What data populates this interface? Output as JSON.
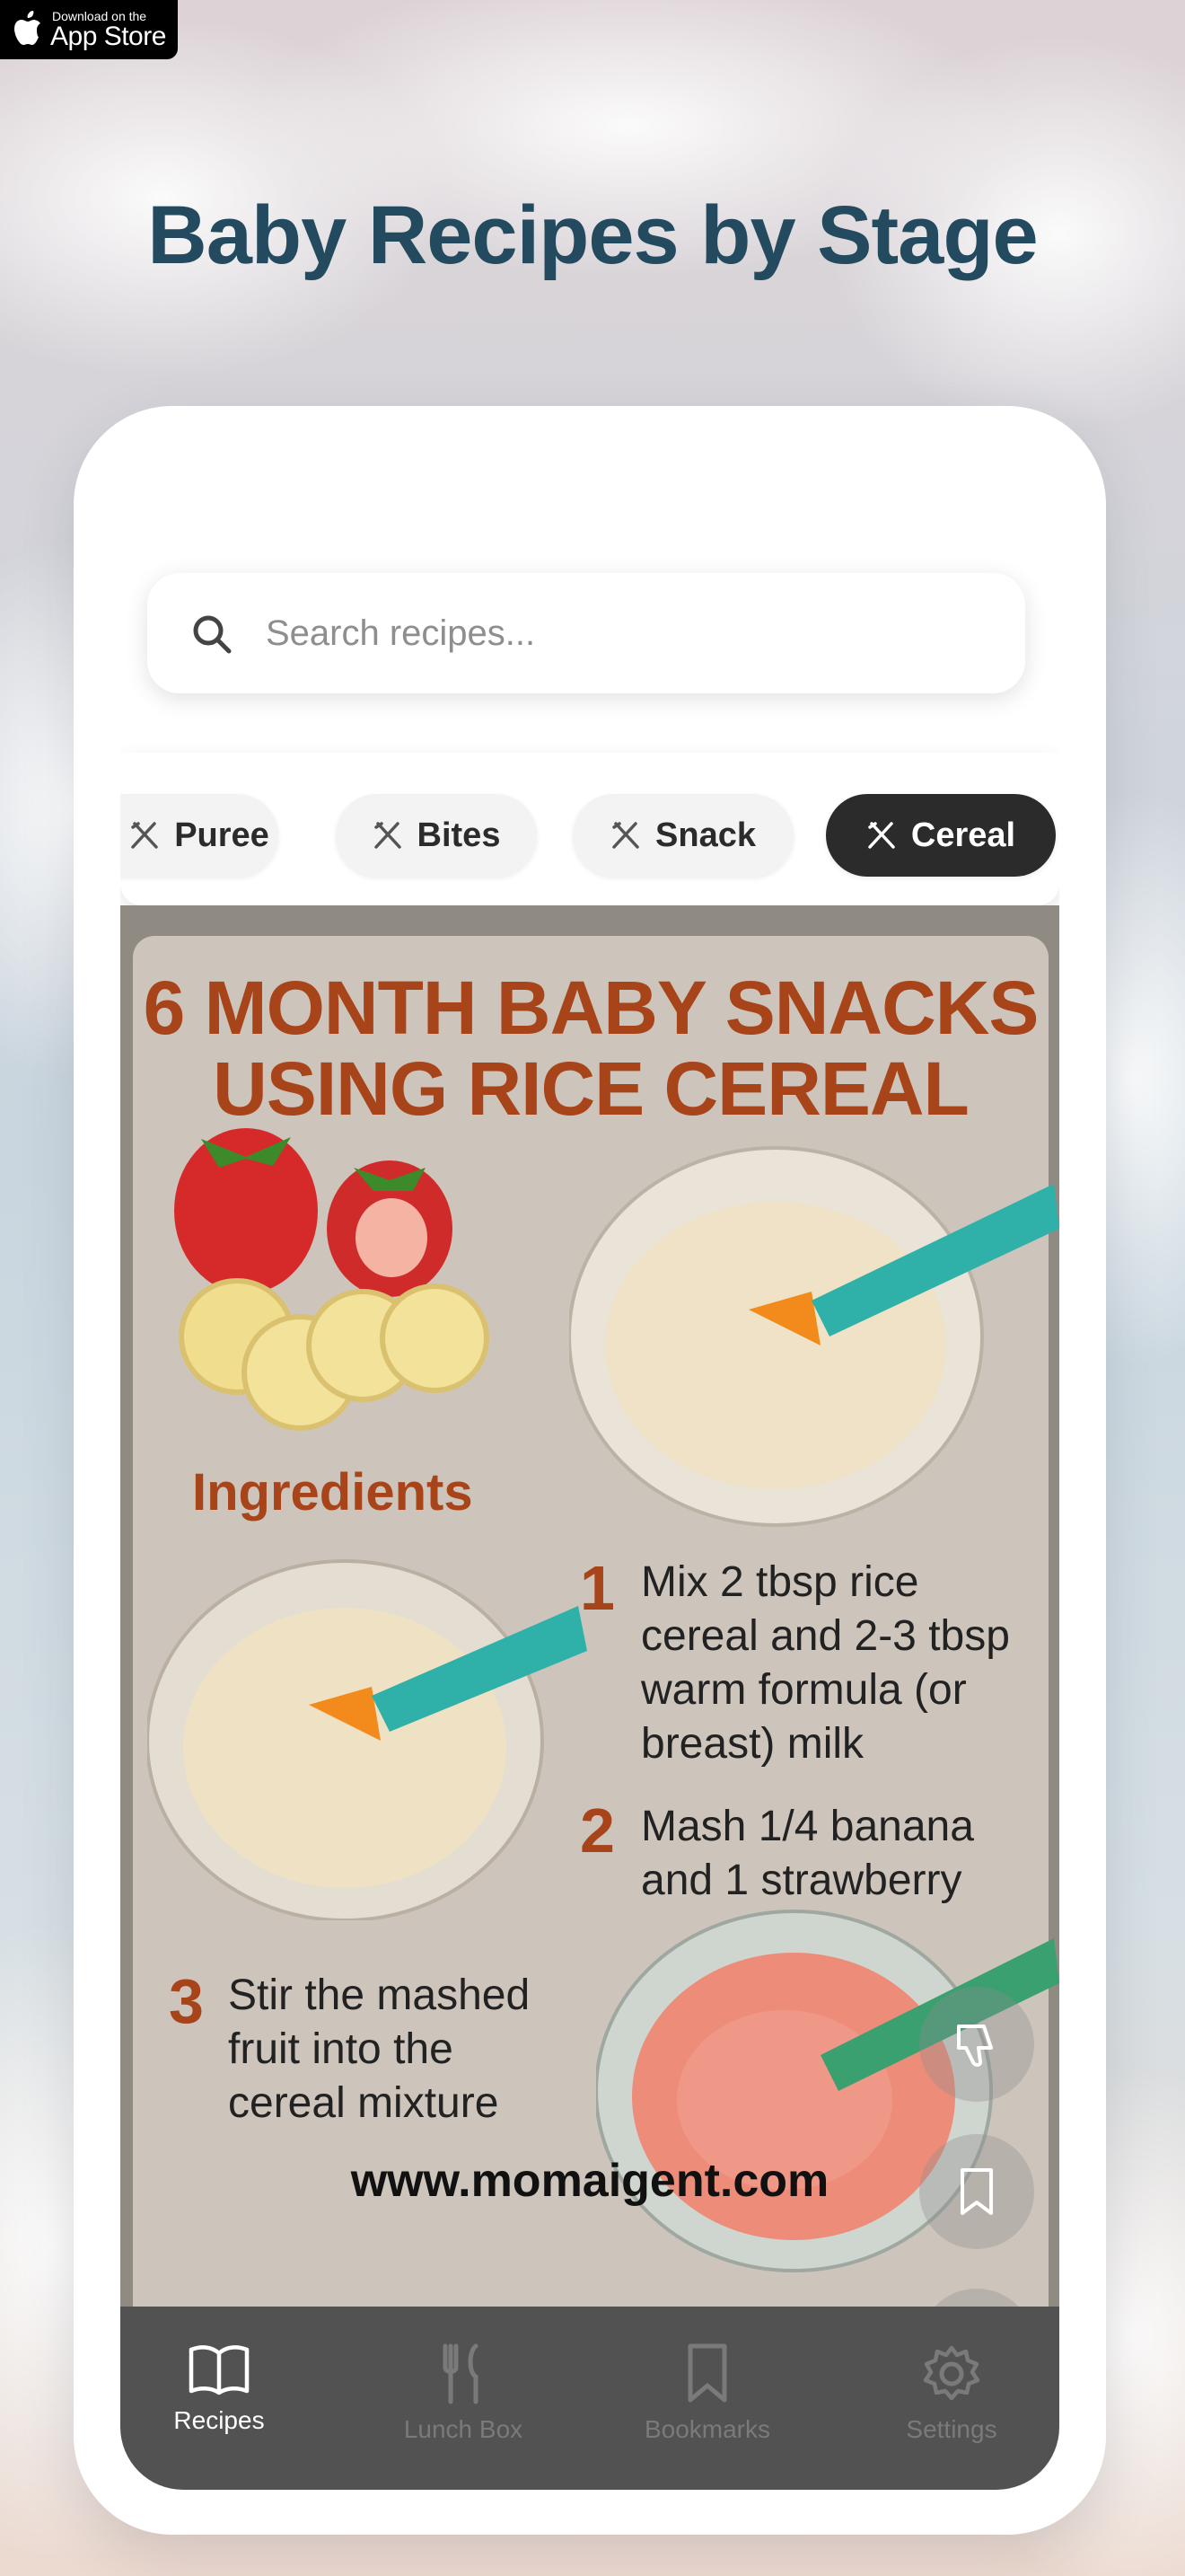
{
  "badge": {
    "line1": "Download on the",
    "line2": "App Store"
  },
  "headline": "Baby Recipes by Stage",
  "search": {
    "placeholder": "Search recipes..."
  },
  "chips": [
    {
      "label": "Puree",
      "active": false
    },
    {
      "label": "Bites",
      "active": false
    },
    {
      "label": "Snack",
      "active": false
    },
    {
      "label": "Cereal",
      "active": true
    }
  ],
  "recipe_card": {
    "title_line1": "6 MONTH BABY SNACKS",
    "title_line2": "USING RICE CEREAL",
    "ingredients_heading": "Ingredients",
    "steps": [
      {
        "num": "1",
        "lines": [
          "Mix 2 tbsp rice",
          "cereal and 2-3 tbsp",
          "warm formula (or",
          "breast) milk"
        ]
      },
      {
        "num": "2",
        "lines": [
          "Mash 1/4 banana",
          "and 1 strawberry"
        ]
      },
      {
        "num": "3",
        "lines": [
          "Stir the mashed",
          "fruit into the",
          "cereal mixture"
        ]
      }
    ],
    "website": "www.momaigent.com"
  },
  "actions": {
    "like_icon": "heart-icon",
    "dislike_icon": "thumbs-down-icon",
    "bookmark_icon": "bookmark-icon"
  },
  "tabs": [
    {
      "label": "Recipes",
      "icon": "book-icon",
      "active": true
    },
    {
      "label": "Lunch Box",
      "icon": "fork-knife-icon",
      "active": false
    },
    {
      "label": "Bookmarks",
      "icon": "bookmark-icon",
      "active": false
    },
    {
      "label": "Settings",
      "icon": "gear-icon",
      "active": false
    }
  ],
  "colors": {
    "headline": "#234a5e",
    "accent": "#a8441a",
    "tabbar": "#525252",
    "active_chip": "#2b2b2b"
  }
}
